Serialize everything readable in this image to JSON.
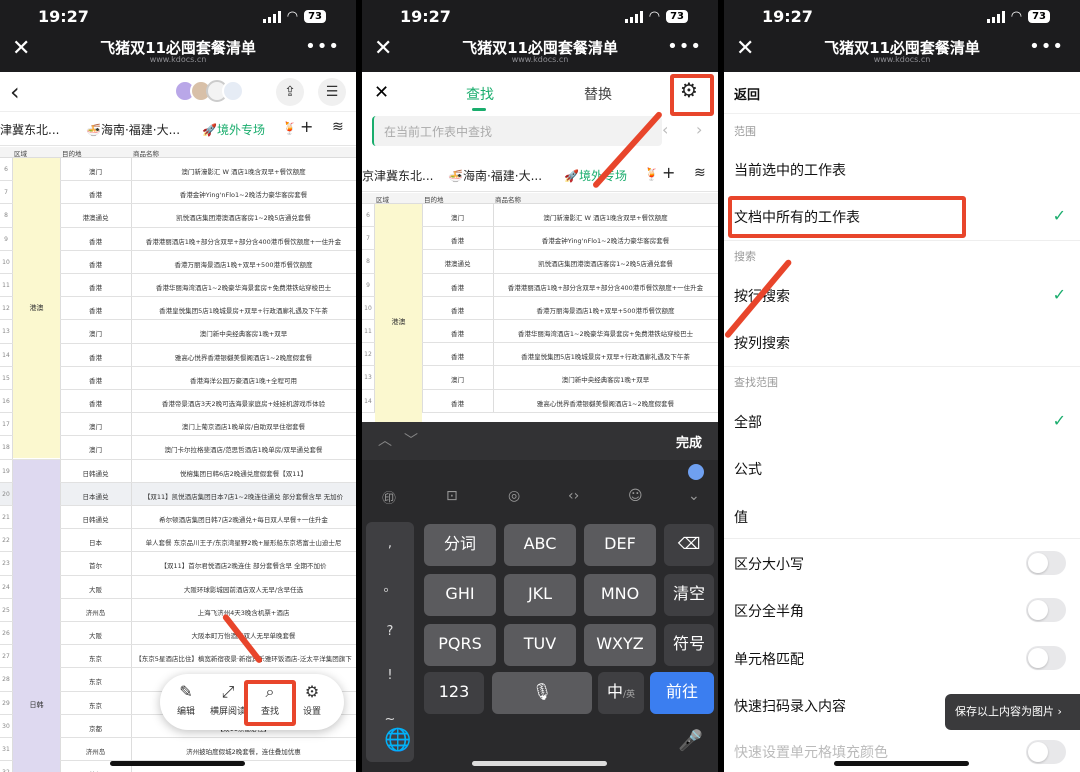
{
  "status": {
    "time": "19:27",
    "battery": "73"
  },
  "doc": {
    "title": "飞猪双11必囤套餐清单",
    "url": "www.kdocs.cn"
  },
  "sheet_tabs": [
    "津冀东北...",
    "🍜海南·福建·大...",
    "🚀境外专场",
    "🍹"
  ],
  "sheet_tabs_p2": [
    "京津冀东北...",
    "🍜海南·福建·大...",
    "🚀境外专场",
    "🍹"
  ],
  "headers": {
    "col_a": "区域",
    "col_b": "目的地",
    "col_c": "商品名称"
  },
  "regions": {
    "hk": "港澳",
    "jk": "日韩"
  },
  "rows1": [
    {
      "n": "6",
      "b": "澳门",
      "c": "澳门新濠影汇 W 酒店1晚含双早+餐饮额度"
    },
    {
      "n": "7",
      "b": "香港",
      "c": "香港金钟Ying'nFlo1~2晚活力豪华客房套餐"
    },
    {
      "n": "8",
      "b": "港澳通兑",
      "c": "凯悦酒店集团港澳酒店客房1~2晚5店通兑套餐"
    },
    {
      "n": "9",
      "b": "香港",
      "c": "香港港丽酒店1晚+部分含双早+部分含400港币餐饮额度+一住升金"
    },
    {
      "n": "10",
      "b": "香港",
      "c": "香港万丽海景酒店1晚+双早+500港币餐饮额度"
    },
    {
      "n": "11",
      "b": "香港",
      "c": "香港华丽海湾酒店1~2晚豪华海景套房+免费港铁站穿梭巴士"
    },
    {
      "n": "12",
      "b": "香港",
      "c": "香港皇悦集团5店1晚城景房+双早+行政酒廊礼遇及下午茶"
    },
    {
      "n": "13",
      "b": "澳门",
      "c": "澳门新中央经典客房1晚+双早"
    },
    {
      "n": "14",
      "b": "香港",
      "c": "雅高心悦界香港银樾美憬阁酒店1~2晚度假套餐"
    },
    {
      "n": "15",
      "b": "香港",
      "c": "香港海洋公园万豪酒店1晚+全程可用"
    },
    {
      "n": "16",
      "b": "香港",
      "c": "香港帝景酒店3天2晚可选海景家庭房+娃娃机游戏币体验"
    },
    {
      "n": "17",
      "b": "澳门",
      "c": "澳门上葡京酒店1晚单房/自助双早住宿套餐"
    },
    {
      "n": "18",
      "b": "澳门",
      "c": "澳门卡尔拉格斐酒店/范思哲酒店1晚单房/双早通兑套餐"
    },
    {
      "n": "19",
      "b": "日韩通兑",
      "c": "悦榕集团日韩6店2晚通兑度假套餐【双11】"
    },
    {
      "n": "20",
      "b": "日本通兑",
      "c": "【双11】凯悦酒店集团日本7店1~2晚连住通兑 部分套餐含早 无加价"
    },
    {
      "n": "21",
      "b": "日韩通兑",
      "c": "希尔顿酒店集团日韩7店2晚通兑+每日双人早餐+一住升金"
    },
    {
      "n": "22",
      "b": "日本",
      "c": "单人套餐 东京品川王子/东京湾星野2晚+屋形船东京塔富士山迪士尼"
    },
    {
      "n": "23",
      "b": "首尔",
      "c": "【双11】首尔君悦酒店2晚连住 部分套餐含早 全期不加价"
    },
    {
      "n": "24",
      "b": "大阪",
      "c": "大阪环球影城园前酒店双人无早/含早任选"
    },
    {
      "n": "25",
      "b": "济州岛",
      "c": "上海飞济州4天3晚含机票+酒店"
    },
    {
      "n": "26",
      "b": "大阪",
      "c": "大阪本町万怡酒店双人无早单晚套餐"
    },
    {
      "n": "27",
      "b": "东京",
      "c": "【东京5星酒店比住】槙宽新宿夜景·新宿宾乐雅环饭酒店-泛太平洋集团旗下"
    },
    {
      "n": "28",
      "b": "东京",
      "c": "建设"
    },
    {
      "n": "29",
      "b": "东京",
      "c": "东"
    },
    {
      "n": "30",
      "b": "京都",
      "c": "【双11京都必住】"
    },
    {
      "n": "31",
      "b": "济州岛",
      "c": "济州披珀度假城2晚套餐，连住叠加优惠"
    },
    {
      "n": "32",
      "b": "首尔",
      "c": ""
    }
  ],
  "rows2": [
    {
      "n": "6",
      "b": "澳门",
      "c": "澳门新濠影汇 W 酒店1晚含双早+餐饮额度"
    },
    {
      "n": "7",
      "b": "香港",
      "c": "香港金钟Ying'nFlo1~2晚活力豪华客房套餐"
    },
    {
      "n": "8",
      "b": "港澳通兑",
      "c": "凯悦酒店集团港澳酒店客房1~2晚5店通兑套餐"
    },
    {
      "n": "9",
      "b": "香港",
      "c": "香港港丽酒店1晚+部分含双早+部分含400港币餐饮额度+一住升金"
    },
    {
      "n": "10",
      "b": "香港",
      "c": "香港万丽海景酒店1晚+双早+500港币餐饮额度"
    },
    {
      "n": "11",
      "b": "香港",
      "c": "香港华丽海湾酒店1~2晚豪华海景套房+免费港铁站穿梭巴士"
    },
    {
      "n": "12",
      "b": "香港",
      "c": "香港皇悦集团5店1晚城景房+双早+行政酒廊礼遇及下午茶"
    },
    {
      "n": "13",
      "b": "澳门",
      "c": "澳门新中央经典客房1晚+双早"
    },
    {
      "n": "14",
      "b": "香港",
      "c": "雅高心悦界香港银樾美憬阁酒店1~2晚度假套餐"
    }
  ],
  "float_bar": {
    "edit": "编辑",
    "landscape": "横屏阅读",
    "find": "查找",
    "settings": "设置"
  },
  "find": {
    "tab_find": "查找",
    "tab_replace": "替换",
    "placeholder": "在当前工作表中查找"
  },
  "keyboard": {
    "done": "完成",
    "side": [
      ",",
      "。",
      "?",
      "!",
      "~"
    ],
    "r1": [
      "分词",
      "ABC",
      "DEF"
    ],
    "r2": [
      "GHI",
      "JKL",
      "MNO",
      "清空"
    ],
    "r3": [
      "PQRS",
      "TUV",
      "WXYZ",
      "符号"
    ],
    "k123": "123",
    "lang": "中",
    "lang_sub": "/英",
    "go": "前往"
  },
  "settings": {
    "back": "返回",
    "sec_scope": "范围",
    "opt_current": "当前选中的工作表",
    "opt_all_sheets": "文档中所有的工作表",
    "sec_search": "搜索",
    "opt_by_row": "按行搜索",
    "opt_by_col": "按列搜索",
    "sec_find_range": "查找范围",
    "opt_all": "全部",
    "opt_formula": "公式",
    "opt_value": "值",
    "opt_case": "区分大小写",
    "opt_width": "区分全半角",
    "opt_cell": "单元格匹配",
    "opt_scan": "快速扫码录入内容",
    "opt_last": "快速设置单元格填充颜色",
    "save_tip": "保存以上内容为图片"
  }
}
